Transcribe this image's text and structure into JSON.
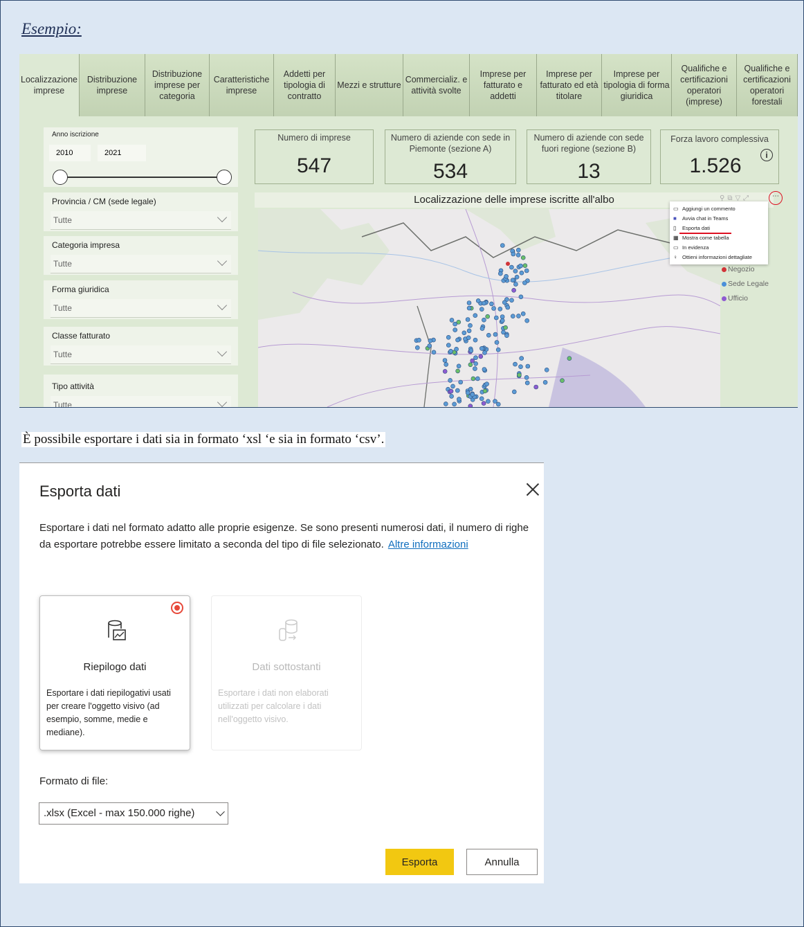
{
  "heading": "Esempio:",
  "tabs": [
    "Localizzazione imprese",
    "Distribuzione imprese",
    "Distribuzione imprese per categoria",
    "Caratteristiche imprese",
    "Addetti per tipologia di contratto",
    "Mezzi e strutture",
    "Commercializ. e attività svolte",
    "Imprese per fatturato e addetti",
    "Imprese per fatturato ed età titolare",
    "Imprese per tipologia di forma giuridica",
    "Qualifiche e certificazioni operatori (imprese)",
    "Qualifiche e certificazioni operatori forestali"
  ],
  "slicer": {
    "label": "Anno iscrizione",
    "from": "2010",
    "to": "2021"
  },
  "filters": [
    {
      "label": "Provincia / CM (sede legale)",
      "value": "Tutte"
    },
    {
      "label": "Categoria impresa",
      "value": "Tutte"
    },
    {
      "label": "Forma giuridica",
      "value": "Tutte"
    },
    {
      "label": "Classe fatturato",
      "value": "Tutte"
    },
    {
      "label": "Tipo attività",
      "value": "Tutte"
    }
  ],
  "kpis": [
    {
      "title": "Numero di imprese",
      "value": "547"
    },
    {
      "title": "Numero di aziende con sede in Piemonte (sezione A)",
      "value": "534"
    },
    {
      "title": "Numero di aziende con sede fuori regione (sezione B)",
      "value": "13"
    },
    {
      "title": "Forza lavoro complessiva",
      "value": "1.526"
    }
  ],
  "map_title": "Localizzazione delle imprese iscritte all'albo",
  "context_menu": [
    "Aggiungi un commento",
    "Avvia chat in Teams",
    "Esporta dati",
    "Mostra come tabella",
    "In evidenza",
    "Ottieni informazioni dettagliate"
  ],
  "legend": [
    {
      "label": "Negozio",
      "color": "#d13438"
    },
    {
      "label": "Sede Legale",
      "color": "#4a90d9"
    },
    {
      "label": "Ufficio",
      "color": "#8e5bd1"
    }
  ],
  "paragraph": "È possibile esportare i dati sia in formato ‘xsl ‘e sia in formato ‘csv’.",
  "dialog": {
    "title": "Esporta dati",
    "description": "Esportare i dati nel formato adatto alle proprie esigenze. Se sono presenti numerosi dati, il numero di righe da esportare potrebbe essere limitato a seconda del tipo di file selezionato.",
    "link": "Altre informazioni",
    "option_summary": {
      "title": "Riepilogo dati",
      "body": "Esportare i dati riepilogativi usati per creare l'oggetto visivo (ad esempio, somme, medie e mediane)."
    },
    "option_underlying": {
      "title": "Dati sottostanti",
      "body": "Esportare i dati non elaborati utilizzati per calcolare i dati nell'oggetto visivo."
    },
    "format_label": "Formato di file:",
    "format_value": ".xlsx (Excel - max 150.000 righe)",
    "export_button": "Esporta",
    "cancel_button": "Annulla"
  }
}
